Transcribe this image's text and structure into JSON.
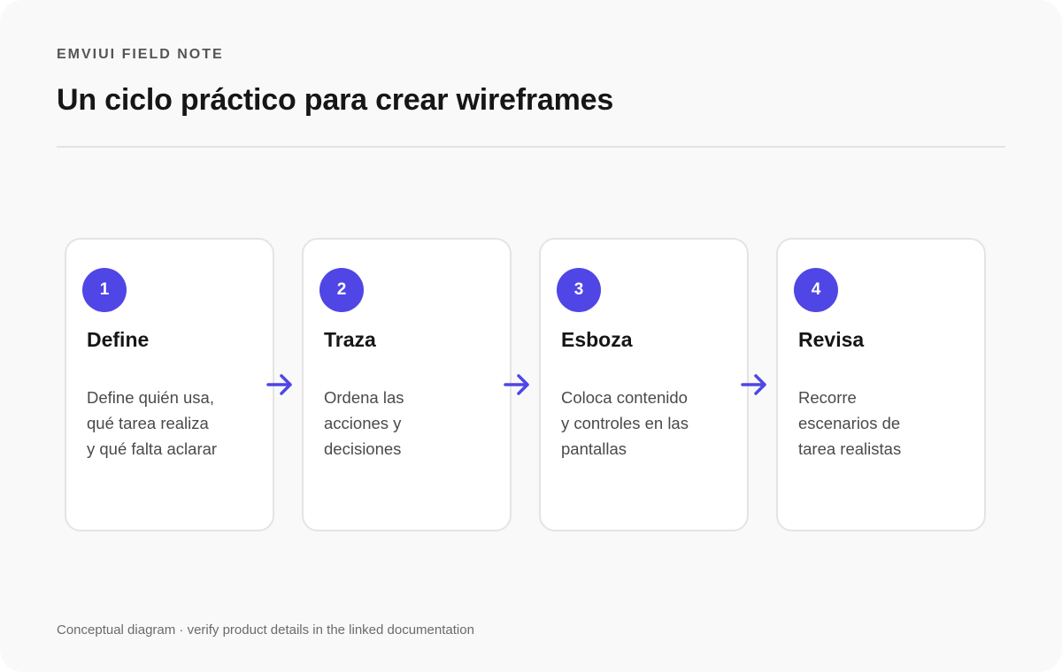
{
  "header": {
    "eyebrow": "EMVIUI FIELD NOTE",
    "title": "Un ciclo práctico para crear wireframes"
  },
  "steps": [
    {
      "number": "1",
      "title": "Define",
      "description": "Define quién usa, qué tarea realiza y qué falta aclarar"
    },
    {
      "number": "2",
      "title": "Traza",
      "description": "Ordena las acciones y decisiones"
    },
    {
      "number": "3",
      "title": "Esboza",
      "description": "Coloca contenido y controles en las pantallas"
    },
    {
      "number": "4",
      "title": "Revisa",
      "description": "Recorre escenarios de tarea realistas"
    }
  ],
  "footer": {
    "note": "Conceptual diagram · verify product details in the linked documentation"
  },
  "colors": {
    "accent": "#4f46e5",
    "background": "#f9f9f9",
    "card_border": "#e4e4e4"
  },
  "icons": {
    "connector": "arrow-right-icon"
  }
}
